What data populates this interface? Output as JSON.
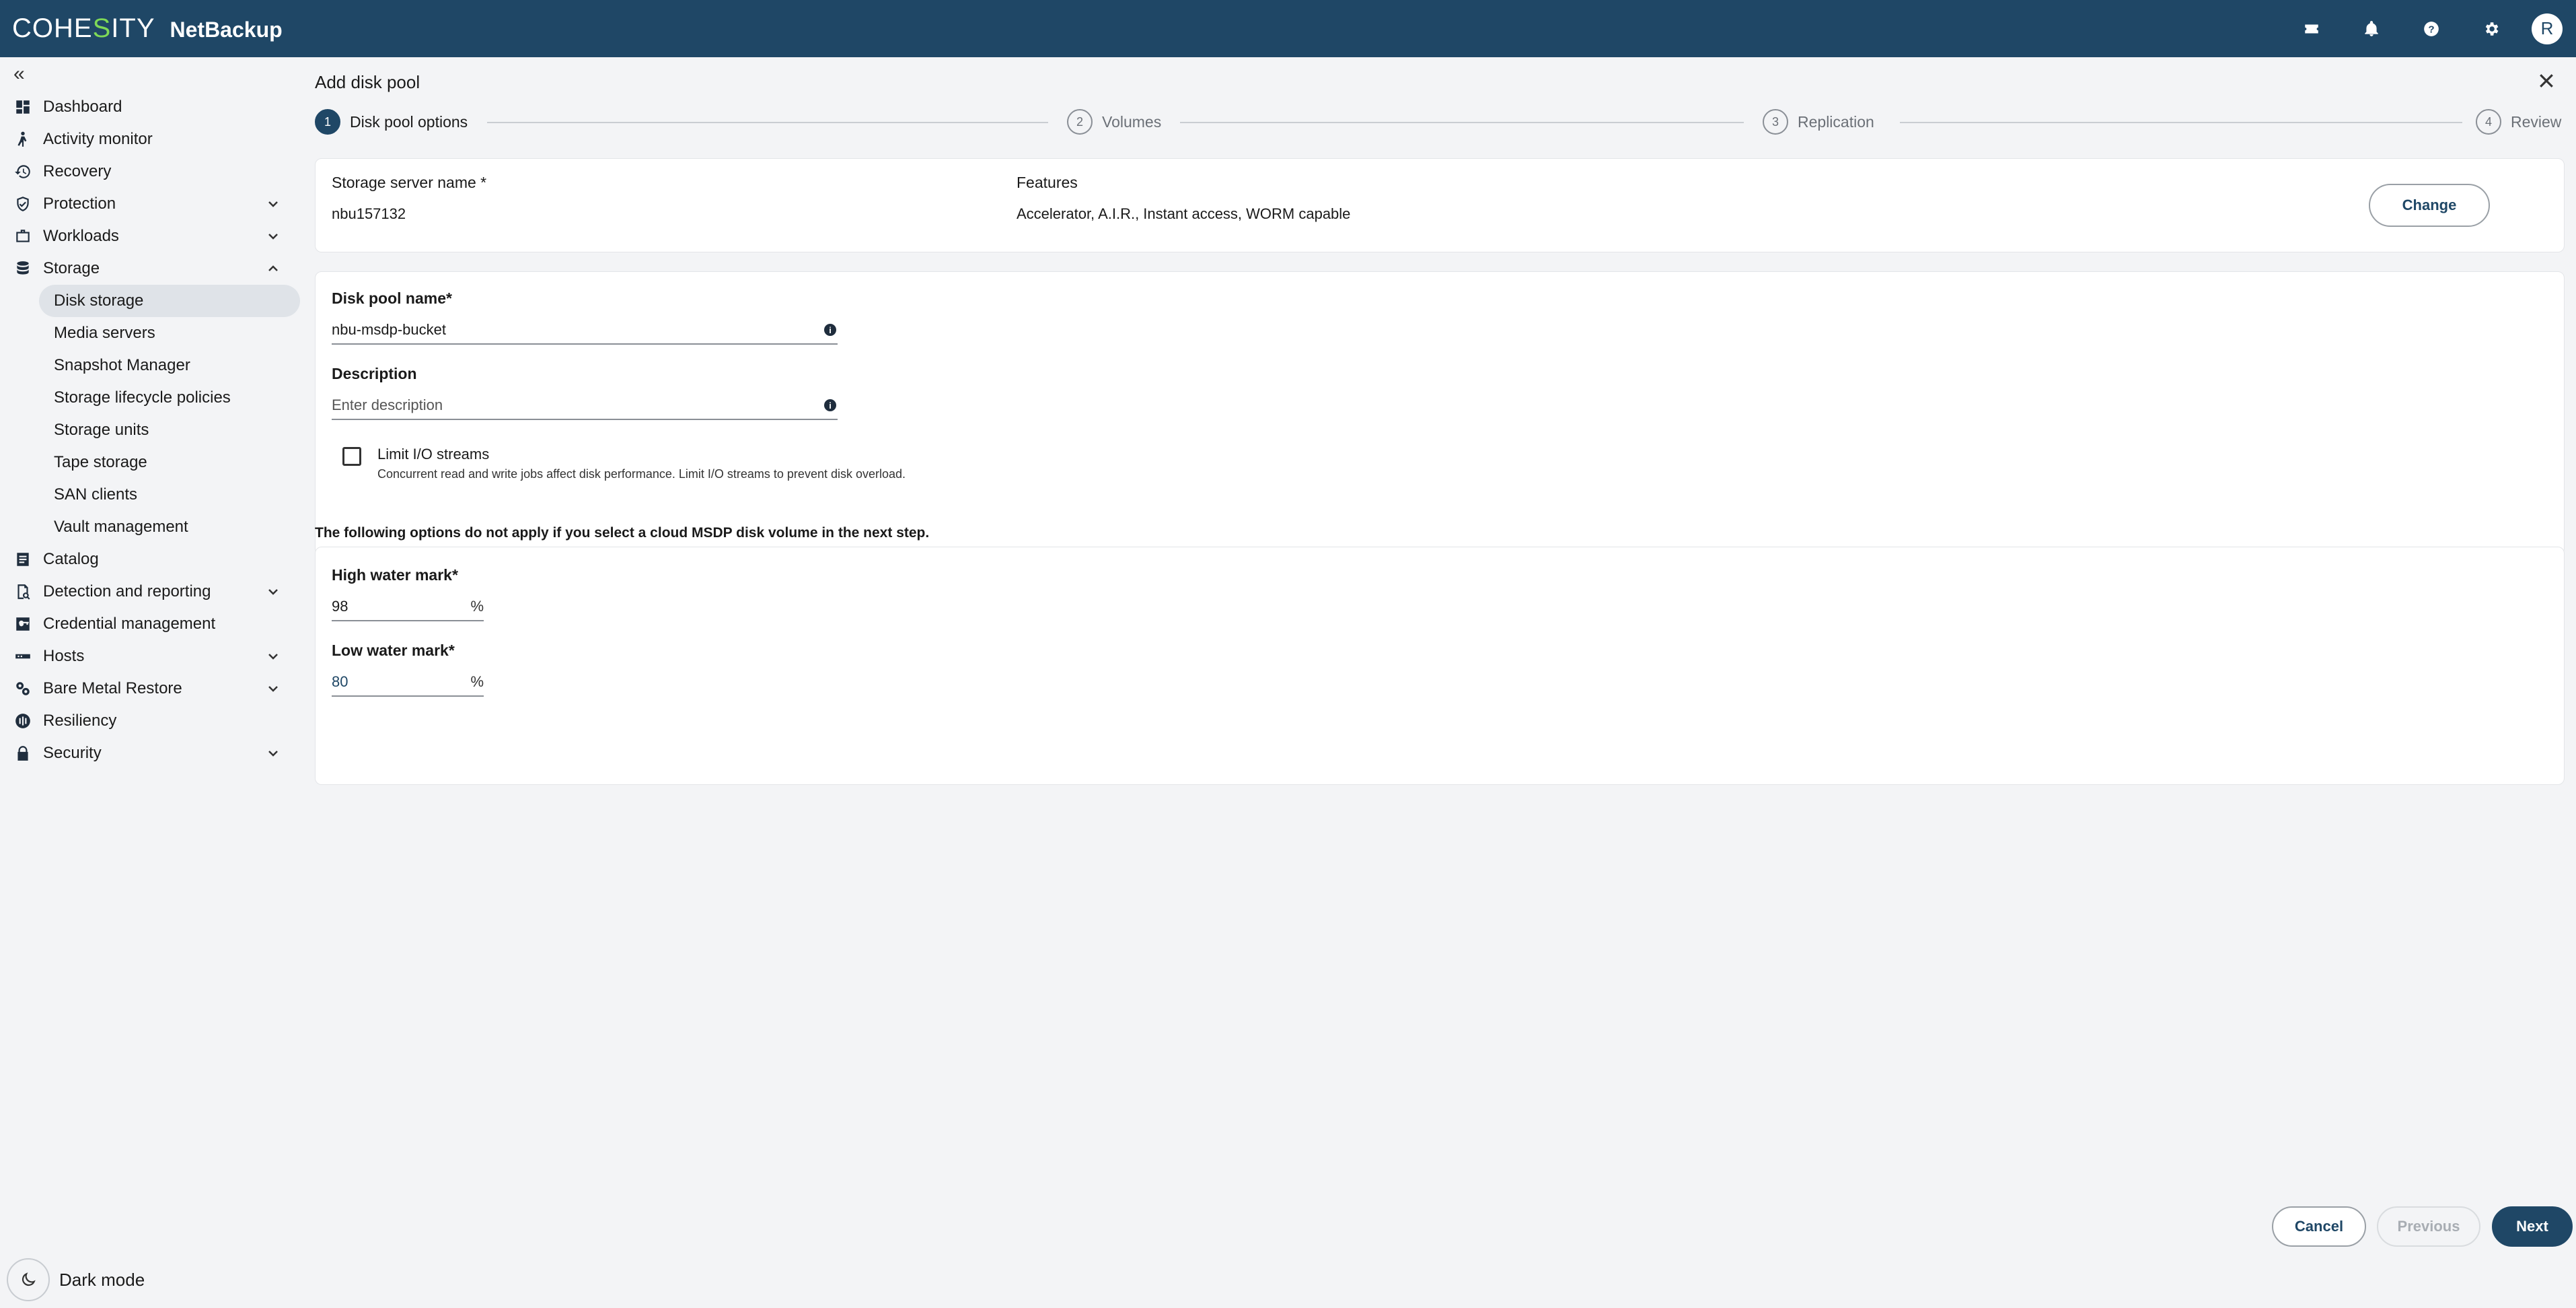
{
  "topbar": {
    "brand_logo_left": "COHE",
    "brand_logo_accent": "S",
    "brand_logo_right": "ITY",
    "product": "NetBackup",
    "avatar_initial": "R"
  },
  "sidebar": {
    "collapse_glyph": "«",
    "items": [
      {
        "label": "Dashboard"
      },
      {
        "label": "Activity monitor"
      },
      {
        "label": "Recovery"
      },
      {
        "label": "Protection"
      },
      {
        "label": "Workloads"
      },
      {
        "label": "Storage"
      },
      {
        "label": "Catalog"
      },
      {
        "label": "Detection and reporting"
      },
      {
        "label": "Credential management"
      },
      {
        "label": "Hosts"
      },
      {
        "label": "Bare Metal Restore"
      },
      {
        "label": "Resiliency"
      },
      {
        "label": "Security"
      }
    ],
    "storage_sub": [
      {
        "label": "Disk storage"
      },
      {
        "label": "Media servers"
      },
      {
        "label": "Snapshot Manager"
      },
      {
        "label": "Storage lifecycle policies"
      },
      {
        "label": "Storage units"
      },
      {
        "label": "Tape storage"
      },
      {
        "label": "SAN clients"
      },
      {
        "label": "Vault management"
      }
    ],
    "dark_mode_label": "Dark mode"
  },
  "main": {
    "title": "Add disk pool",
    "steps": [
      {
        "num": "1",
        "label": "Disk pool options"
      },
      {
        "num": "2",
        "label": "Volumes"
      },
      {
        "num": "3",
        "label": "Replication"
      },
      {
        "num": "4",
        "label": "Review"
      }
    ],
    "server": {
      "name_label": "Storage server name *",
      "name_value": "nbu157132",
      "features_label": "Features",
      "features_value": "Accelerator, A.I.R., Instant access, WORM capable",
      "change_label": "Change"
    },
    "pool": {
      "name_label": "Disk pool name*",
      "name_value": "nbu-msdp-bucket",
      "desc_label": "Description",
      "desc_placeholder": "Enter description",
      "limit_label": "Limit I/O streams",
      "limit_desc": "Concurrent read and write jobs affect disk performance. Limit I/O streams to prevent disk overload."
    },
    "notice": "The following options do not apply if you select a cloud MSDP disk volume in the next step.",
    "watermarks": {
      "high_label": "High water mark*",
      "high_value": "98",
      "low_label": "Low water mark*",
      "low_value": "80",
      "unit": "%"
    }
  },
  "footer": {
    "cancel": "Cancel",
    "previous": "Previous",
    "next": "Next"
  }
}
